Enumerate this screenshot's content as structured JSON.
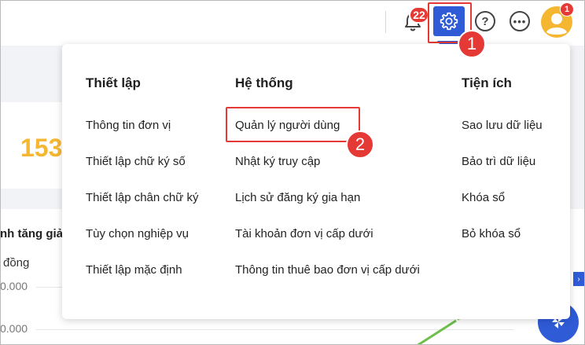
{
  "header": {
    "notification_count": "22",
    "help_icon": "question-circle-icon",
    "more_icon": "ellipsis-circle-icon",
    "avatar_badge": "1",
    "accent_color": "#2f5bd7",
    "annotation_color": "#e53935"
  },
  "annotations": {
    "step1": "1",
    "step2": "2"
  },
  "background": {
    "big_number": "153",
    "chart_title": "nh tăng giả",
    "chart_unit": "đồng",
    "tick_1": "0.000",
    "tick_2": "0.000"
  },
  "menu": {
    "columns": [
      {
        "heading": "Thiết lập",
        "items": [
          "Thông tin đơn vị",
          "Thiết lập chữ ký số",
          "Thiết lập chân chữ ký",
          "Tùy chọn nghiệp vụ",
          "Thiết lập mặc định"
        ]
      },
      {
        "heading": "Hệ thống",
        "items": [
          "Quản lý người dùng",
          "Nhật ký truy cập",
          "Lịch sử đăng ký gia hạn",
          "Tài khoản đơn vị cấp dưới",
          "Thông tin thuê bao đơn vị cấp dưới"
        ]
      },
      {
        "heading": "Tiện ích",
        "items": [
          "Sao lưu dữ liệu",
          "Bảo trì dữ liệu",
          "Khóa sổ",
          "Bỏ khóa sổ"
        ]
      }
    ]
  }
}
